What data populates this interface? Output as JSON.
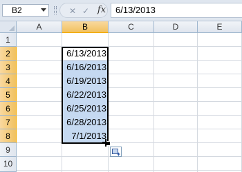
{
  "formula_bar": {
    "name_box": "B2",
    "fx_label": "fx",
    "cancel_glyph": "✕",
    "enter_glyph": "✓",
    "formula_value": "6/13/2013"
  },
  "columns": [
    "A",
    "B",
    "C",
    "D",
    "E"
  ],
  "rows": [
    "1",
    "2",
    "3",
    "4",
    "5",
    "6",
    "7",
    "8",
    "9",
    "10"
  ],
  "selected_column": "B",
  "cells": {
    "B2": "6/13/2013",
    "B3": "6/16/2013",
    "B4": "6/19/2013",
    "B5": "6/22/2013",
    "B6": "6/25/2013",
    "B7": "6/28/2013",
    "B8": "7/1/2013"
  },
  "icons": {
    "fill_handle_cursor": "plus-cross-icon",
    "autofill_options": "autofill-options-icon"
  },
  "colors": {
    "selection_fill": "#c5d9f1",
    "header_selected": "#f1c15f"
  }
}
